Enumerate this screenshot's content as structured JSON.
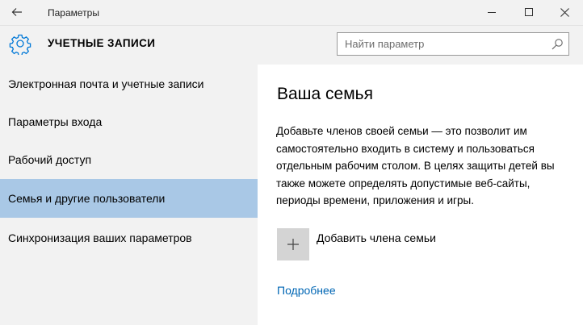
{
  "window": {
    "title": "Параметры",
    "back_icon": "back-arrow-icon",
    "controls": [
      "minimize-icon",
      "maximize-icon",
      "close-icon"
    ]
  },
  "header": {
    "icon": "gear-icon",
    "title": "УЧЕТНЫЕ ЗАПИСИ",
    "search": {
      "placeholder": "Найти параметр",
      "value": "",
      "icon": "search-icon"
    }
  },
  "sidebar": {
    "items": [
      {
        "label": "Электронная почта и учетные записи",
        "selected": false
      },
      {
        "label": "Параметры входа",
        "selected": false
      },
      {
        "label": "Рабочий доступ",
        "selected": false
      },
      {
        "label": "Семья и другие пользователи",
        "selected": true
      },
      {
        "label": "Синхронизация ваших параметров",
        "selected": false
      }
    ]
  },
  "main": {
    "title": "Ваша семья",
    "description": "Добавьте членов своей семьи — это позволит им самостоятельно входить в систему и пользоваться отдельным рабочим столом. В целях защиты детей вы также можете определять допустимые веб-сайты, периоды времени, приложения и игры.",
    "add_member": {
      "icon": "plus-icon",
      "label": "Добавить члена семьи"
    },
    "more_link": "Подробнее"
  },
  "colors": {
    "chrome_bg": "#f2f2f2",
    "selected_bg": "#a9c8e6",
    "link": "#0066b4",
    "accent": "#0078d7",
    "tile_bg": "#d4d4d4"
  }
}
